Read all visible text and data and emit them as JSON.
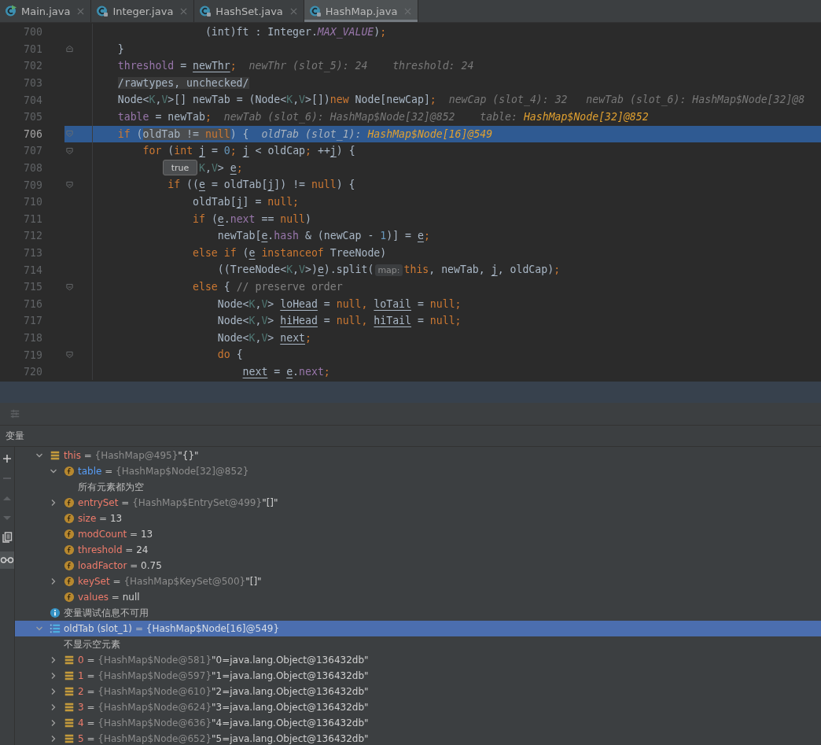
{
  "tabs": [
    {
      "label": "Main.java",
      "kind": "runnable",
      "selected": false
    },
    {
      "label": "Integer.java",
      "kind": "library",
      "selected": false
    },
    {
      "label": "HashSet.java",
      "kind": "library",
      "selected": false
    },
    {
      "label": "HashMap.java",
      "kind": "library",
      "selected": true
    }
  ],
  "editor": {
    "lines": [
      {
        "number": "700",
        "kind": "plain",
        "current": false,
        "segments": [
          {
            "t": "                  (int)ft : Integer.",
            "kind": "plain"
          },
          {
            "t": "MAX_VALUE",
            "kind": "const"
          },
          {
            "t": ")",
            "kind": "plain"
          },
          {
            "t": ";",
            "kind": "kw"
          }
        ]
      },
      {
        "number": "701",
        "kind": "block-end",
        "current": false,
        "segments": [
          {
            "t": "    }",
            "kind": "plain"
          }
        ]
      },
      {
        "number": "702",
        "kind": "plain",
        "current": false,
        "segments": [
          {
            "t": "    threshold",
            "kind": "field"
          },
          {
            "t": " = ",
            "kind": "plain"
          },
          {
            "t": "newThr",
            "kind": "under"
          },
          {
            "t": ";",
            "kind": "kw"
          },
          {
            "t": "  newThr (slot_5): 24    threshold: 24",
            "kind": "hint"
          }
        ]
      },
      {
        "number": "703",
        "kind": "plain",
        "current": false,
        "segments": [
          {
            "t": "    /rawtypes, unchecked/",
            "kind": "annot"
          }
        ]
      },
      {
        "number": "704",
        "kind": "plain",
        "current": false,
        "segments": [
          {
            "t": "    Node<",
            "kind": "plain"
          },
          {
            "t": "K",
            "kind": "tparam"
          },
          {
            "t": ",",
            "kind": "plain"
          },
          {
            "t": "V",
            "kind": "tparam"
          },
          {
            "t": ">[] newTab = (Node<",
            "kind": "plain"
          },
          {
            "t": "K",
            "kind": "tparam"
          },
          {
            "t": ",",
            "kind": "plain"
          },
          {
            "t": "V",
            "kind": "tparam"
          },
          {
            "t": ">[])",
            "kind": "plain"
          },
          {
            "t": "new",
            "kind": "kw"
          },
          {
            "t": " Node[newCap]",
            "kind": "plain"
          },
          {
            "t": ";",
            "kind": "kw"
          },
          {
            "t": "  newCap (slot_4): 32   newTab (slot_6): HashMap$Node[32]@8",
            "kind": "hint"
          }
        ]
      },
      {
        "number": "705",
        "kind": "plain",
        "current": false,
        "segments": [
          {
            "t": "    table",
            "kind": "field"
          },
          {
            "t": " = newTab",
            "kind": "plain"
          },
          {
            "t": ";",
            "kind": "kw"
          },
          {
            "t": "  newTab (slot_6): HashMap$Node[32]@852    table: ",
            "kind": "hint"
          },
          {
            "t": "HashMap$Node[32]@852",
            "kind": "hintval"
          }
        ]
      },
      {
        "number": "706",
        "kind": "block-start",
        "current": true,
        "segments": [
          {
            "t": "    if",
            "kind": "kw"
          },
          {
            "t": " (",
            "kind": "plain"
          },
          {
            "t": "oldTab != ",
            "kind": "eval"
          },
          {
            "t": "null",
            "kind": "evalkw"
          },
          {
            "t": ") {",
            "kind": "plain"
          },
          {
            "t": "  oldTab (slot_1): ",
            "kind": "hint"
          },
          {
            "t": "HashMap$Node[16]@549",
            "kind": "hintval"
          }
        ]
      },
      {
        "number": "707",
        "kind": "block-start",
        "current": false,
        "segments": [
          {
            "t": "        for",
            "kind": "kw"
          },
          {
            "t": " (",
            "kind": "plain"
          },
          {
            "t": "int ",
            "kind": "kw"
          },
          {
            "t": "j",
            "kind": "under"
          },
          {
            "t": " = ",
            "kind": "plain"
          },
          {
            "t": "0",
            "kind": "num"
          },
          {
            "t": "; ",
            "kind": "kw"
          },
          {
            "t": "j",
            "kind": "under"
          },
          {
            "t": " < oldCap",
            "kind": "plain"
          },
          {
            "t": ";",
            "kind": "kw"
          },
          {
            "t": " ++",
            "kind": "plain"
          },
          {
            "t": "j",
            "kind": "under"
          },
          {
            "t": ") {",
            "kind": "plain"
          }
        ]
      },
      {
        "number": "708",
        "kind": "plain",
        "current": false,
        "segments": [
          {
            "t": "                 K",
            "kind": "tparam"
          },
          {
            "t": ",",
            "kind": "plain"
          },
          {
            "t": "V",
            "kind": "tparam"
          },
          {
            "t": "> ",
            "kind": "plain"
          },
          {
            "t": "e",
            "kind": "under"
          },
          {
            "t": ";",
            "kind": "kw"
          }
        ]
      },
      {
        "number": "709",
        "kind": "block-start",
        "current": false,
        "segments": [
          {
            "t": "            if",
            "kind": "kw"
          },
          {
            "t": " ((",
            "kind": "plain"
          },
          {
            "t": "e",
            "kind": "under"
          },
          {
            "t": " = oldTab[",
            "kind": "plain"
          },
          {
            "t": "j",
            "kind": "under"
          },
          {
            "t": "]) != ",
            "kind": "plain"
          },
          {
            "t": "null",
            "kind": "kw"
          },
          {
            "t": ") {",
            "kind": "plain"
          }
        ]
      },
      {
        "number": "710",
        "kind": "plain",
        "current": false,
        "segments": [
          {
            "t": "                oldTab[",
            "kind": "plain"
          },
          {
            "t": "j",
            "kind": "under"
          },
          {
            "t": "] = ",
            "kind": "plain"
          },
          {
            "t": "null;",
            "kind": "kw"
          }
        ]
      },
      {
        "number": "711",
        "kind": "plain",
        "current": false,
        "segments": [
          {
            "t": "                if",
            "kind": "kw"
          },
          {
            "t": " (",
            "kind": "plain"
          },
          {
            "t": "e",
            "kind": "under"
          },
          {
            "t": ".",
            "kind": "plain"
          },
          {
            "t": "next",
            "kind": "field"
          },
          {
            "t": " == ",
            "kind": "plain"
          },
          {
            "t": "null",
            "kind": "kw"
          },
          {
            "t": ")",
            "kind": "plain"
          }
        ]
      },
      {
        "number": "712",
        "kind": "plain",
        "current": false,
        "segments": [
          {
            "t": "                    newTab[",
            "kind": "plain"
          },
          {
            "t": "e",
            "kind": "under"
          },
          {
            "t": ".",
            "kind": "plain"
          },
          {
            "t": "hash",
            "kind": "field"
          },
          {
            "t": " & (newCap - ",
            "kind": "plain"
          },
          {
            "t": "1",
            "kind": "num"
          },
          {
            "t": ")] = ",
            "kind": "plain"
          },
          {
            "t": "e",
            "kind": "under"
          },
          {
            "t": ";",
            "kind": "kw"
          }
        ]
      },
      {
        "number": "713",
        "kind": "plain",
        "current": false,
        "segments": [
          {
            "t": "                else if",
            "kind": "kw"
          },
          {
            "t": " (",
            "kind": "plain"
          },
          {
            "t": "e",
            "kind": "under"
          },
          {
            "t": " instanceof",
            "kind": "kw"
          },
          {
            "t": " TreeNode)",
            "kind": "plain"
          }
        ]
      },
      {
        "number": "714",
        "kind": "plain",
        "current": false,
        "segments": [
          {
            "t": "                    ((TreeNode<",
            "kind": "plain"
          },
          {
            "t": "K",
            "kind": "tparam"
          },
          {
            "t": ",",
            "kind": "plain"
          },
          {
            "t": "V",
            "kind": "tparam"
          },
          {
            "t": ">)",
            "kind": "plain"
          },
          {
            "t": "e",
            "kind": "under"
          },
          {
            "t": ").split(",
            "kind": "plain"
          },
          {
            "t": "map:",
            "kind": "paramhint"
          },
          {
            "t": "this",
            "kind": "kw"
          },
          {
            "t": ", newTab, ",
            "kind": "plain"
          },
          {
            "t": "j",
            "kind": "under"
          },
          {
            "t": ", oldCap)",
            "kind": "plain"
          },
          {
            "t": ";",
            "kind": "kw"
          }
        ]
      },
      {
        "number": "715",
        "kind": "block-start",
        "current": false,
        "segments": [
          {
            "t": "                else",
            "kind": "kw"
          },
          {
            "t": " { ",
            "kind": "plain"
          },
          {
            "t": "// preserve order",
            "kind": "comment"
          }
        ]
      },
      {
        "number": "716",
        "kind": "plain",
        "current": false,
        "segments": [
          {
            "t": "                    Node<",
            "kind": "plain"
          },
          {
            "t": "K",
            "kind": "tparam"
          },
          {
            "t": ",",
            "kind": "plain"
          },
          {
            "t": "V",
            "kind": "tparam"
          },
          {
            "t": "> ",
            "kind": "plain"
          },
          {
            "t": "loHead",
            "kind": "under"
          },
          {
            "t": " = ",
            "kind": "plain"
          },
          {
            "t": "null, ",
            "kind": "kw"
          },
          {
            "t": "loTail",
            "kind": "under"
          },
          {
            "t": " = ",
            "kind": "plain"
          },
          {
            "t": "null;",
            "kind": "kw"
          }
        ]
      },
      {
        "number": "717",
        "kind": "plain",
        "current": false,
        "segments": [
          {
            "t": "                    Node<",
            "kind": "plain"
          },
          {
            "t": "K",
            "kind": "tparam"
          },
          {
            "t": ",",
            "kind": "plain"
          },
          {
            "t": "V",
            "kind": "tparam"
          },
          {
            "t": "> ",
            "kind": "plain"
          },
          {
            "t": "hiHead",
            "kind": "under"
          },
          {
            "t": " = ",
            "kind": "plain"
          },
          {
            "t": "null, ",
            "kind": "kw"
          },
          {
            "t": "hiTail",
            "kind": "under"
          },
          {
            "t": " = ",
            "kind": "plain"
          },
          {
            "t": "null;",
            "kind": "kw"
          }
        ]
      },
      {
        "number": "718",
        "kind": "plain",
        "current": false,
        "segments": [
          {
            "t": "                    Node<",
            "kind": "plain"
          },
          {
            "t": "K",
            "kind": "tparam"
          },
          {
            "t": ",",
            "kind": "plain"
          },
          {
            "t": "V",
            "kind": "tparam"
          },
          {
            "t": "> ",
            "kind": "plain"
          },
          {
            "t": "next",
            "kind": "under"
          },
          {
            "t": ";",
            "kind": "kw"
          }
        ]
      },
      {
        "number": "719",
        "kind": "block-start",
        "current": false,
        "segments": [
          {
            "t": "                    do",
            "kind": "kw"
          },
          {
            "t": " {",
            "kind": "plain"
          }
        ]
      },
      {
        "number": "720",
        "kind": "plain",
        "current": false,
        "segments": [
          {
            "t": "                        next",
            "kind": "under"
          },
          {
            "t": " = ",
            "kind": "plain"
          },
          {
            "t": "e",
            "kind": "under"
          },
          {
            "t": ".",
            "kind": "plain"
          },
          {
            "t": "next",
            "kind": "field"
          },
          {
            "t": ";",
            "kind": "kw"
          }
        ]
      }
    ],
    "tooltip": "true"
  },
  "variables": {
    "title": "变量",
    "items": [
      {
        "kind": "object",
        "name": "this",
        "op": "=",
        "ref": "{HashMap@495}",
        "value": "\"{}\"",
        "expanded": true,
        "selected": false,
        "changed": false,
        "children": [
          {
            "kind": "field",
            "name": "table",
            "op": "=",
            "ref": "{HashMap$Node[32]@852}",
            "expanded": true,
            "selected": false,
            "changed": true,
            "children": [
              {
                "kind": "note",
                "text": "所有元素都为空",
                "selected": false
              }
            ]
          },
          {
            "kind": "field",
            "name": "entrySet",
            "op": "=",
            "ref": "{HashMap$EntrySet@499}",
            "value": "\"[]\"",
            "expanded": false,
            "selected": false,
            "changed": false
          },
          {
            "kind": "field",
            "name": "size",
            "op": "=",
            "value": "13",
            "selected": false,
            "changed": false
          },
          {
            "kind": "field",
            "name": "modCount",
            "op": "=",
            "value": "13",
            "selected": false,
            "changed": false
          },
          {
            "kind": "field",
            "name": "threshold",
            "op": "=",
            "value": "24",
            "selected": false,
            "changed": false
          },
          {
            "kind": "field",
            "name": "loadFactor",
            "op": "=",
            "value": "0.75",
            "selected": false,
            "changed": false
          },
          {
            "kind": "field",
            "name": "keySet",
            "op": "=",
            "ref": "{HashMap$KeySet@500}",
            "value": "\"[]\"",
            "expanded": false,
            "selected": false,
            "changed": false
          },
          {
            "kind": "field",
            "name": "values",
            "op": "=",
            "value": "null",
            "selected": false,
            "changed": false
          }
        ]
      },
      {
        "kind": "info",
        "text": "变量调试信息不可用",
        "selected": false
      },
      {
        "kind": "array",
        "name": "oldTab (slot_1)",
        "op": "=",
        "ref": "{HashMap$Node[16]@549}",
        "expanded": true,
        "selected": true,
        "changed": false,
        "children": [
          {
            "kind": "note",
            "text": "不显示空元素",
            "selected": false
          },
          {
            "kind": "element",
            "name": "0",
            "op": "=",
            "ref": "{HashMap$Node@581}",
            "value": "\"0=java.lang.Object@136432db\"",
            "expanded": false,
            "selected": false,
            "changed": false
          },
          {
            "kind": "element",
            "name": "1",
            "op": "=",
            "ref": "{HashMap$Node@597}",
            "value": "\"1=java.lang.Object@136432db\"",
            "expanded": false,
            "selected": false,
            "changed": false
          },
          {
            "kind": "element",
            "name": "2",
            "op": "=",
            "ref": "{HashMap$Node@610}",
            "value": "\"2=java.lang.Object@136432db\"",
            "expanded": false,
            "selected": false,
            "changed": false
          },
          {
            "kind": "element",
            "name": "3",
            "op": "=",
            "ref": "{HashMap$Node@624}",
            "value": "\"3=java.lang.Object@136432db\"",
            "expanded": false,
            "selected": false,
            "changed": false
          },
          {
            "kind": "element",
            "name": "4",
            "op": "=",
            "ref": "{HashMap$Node@636}",
            "value": "\"4=java.lang.Object@136432db\"",
            "expanded": false,
            "selected": false,
            "changed": false
          },
          {
            "kind": "element",
            "name": "5",
            "op": "=",
            "ref": "{HashMap$Node@652}",
            "value": "\"5=java.lang.Object@136432db\"",
            "expanded": false,
            "selected": false,
            "changed": false
          }
        ]
      }
    ]
  }
}
